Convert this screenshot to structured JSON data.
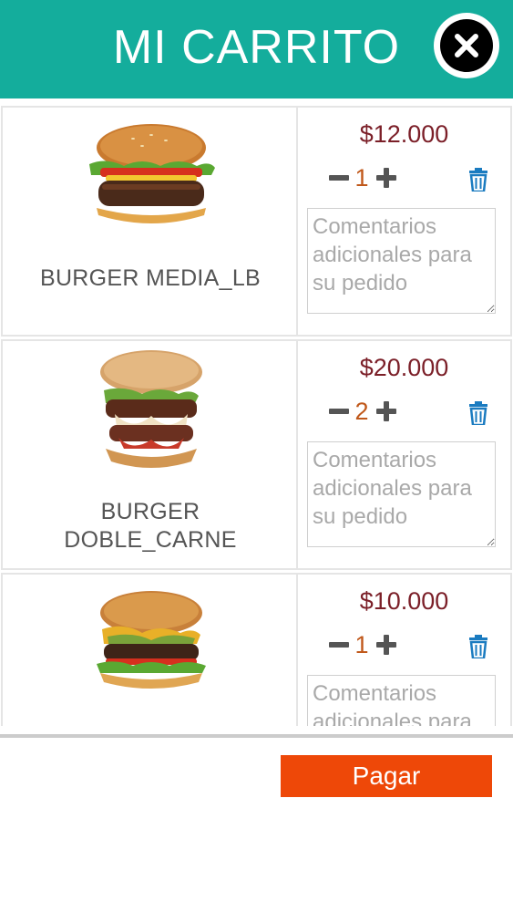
{
  "header": {
    "title": "MI CARRITO",
    "close_icon": "close-icon",
    "color": "#14ad9c"
  },
  "cart": {
    "items": [
      {
        "name": "BURGER MEDIA_LB",
        "price": "$12.000",
        "quantity": "1",
        "comment_value": "",
        "comment_placeholder": "Comentarios adicionales para su pedido",
        "image_icon": "burger-image"
      },
      {
        "name": "BURGER DOBLE_CARNE",
        "price": "$20.000",
        "quantity": "2",
        "comment_value": "",
        "comment_placeholder": "Comentarios adicionales para su pedido",
        "image_icon": "burger-image"
      },
      {
        "name": "",
        "price": "$10.000",
        "quantity": "1",
        "comment_value": "",
        "comment_placeholder": "Comentarios adicionales para su pedido",
        "image_icon": "burger-image"
      }
    ],
    "minus_icon": "minus-icon",
    "plus_icon": "plus-icon",
    "delete_icon": "trash-icon"
  },
  "footer": {
    "pay_label": "Pagar",
    "pay_color": "#ee4808"
  },
  "colors": {
    "price": "#7b1f28",
    "quantity": "#c0581a",
    "trash": "#1a7bc0"
  }
}
